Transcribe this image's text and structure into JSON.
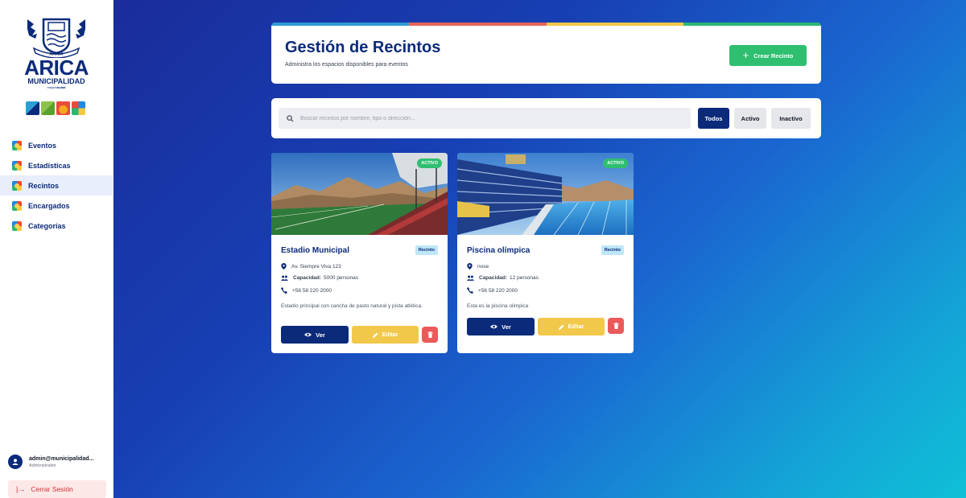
{
  "brand": {
    "name": "ARICA",
    "subtitle": "MUNICIPALIDAD",
    "tagline_prefix": "mejor",
    "tagline_bold": "ciudad",
    "crest_text": "ARICA",
    "tile_colors": [
      "#2a9fd6",
      "#8bc34a",
      "#f5a623",
      "#e94b3c",
      "#1e88e5"
    ]
  },
  "sidebar": {
    "items": [
      {
        "label": "Eventos",
        "active": false
      },
      {
        "label": "Estadísticas",
        "active": false
      },
      {
        "label": "Recintos",
        "active": true
      },
      {
        "label": "Encargados",
        "active": false
      },
      {
        "label": "Categorías",
        "active": false
      }
    ],
    "user": {
      "email": "admin@municipalidad...",
      "role": "Administrador"
    },
    "logout_label": "Cerrar Sesión"
  },
  "header": {
    "title": "Gestión de Recintos",
    "subtitle": "Administra los espacios disponibles para eventos",
    "create_label": "Crear Recinto",
    "stripe_colors": [
      "#2e9bd6",
      "#e8635a",
      "#f2c84b",
      "#2bb673"
    ]
  },
  "search": {
    "placeholder": "Buscar recintos por nombre, tipo o dirección...",
    "filters": [
      {
        "label": "Todos",
        "selected": true
      },
      {
        "label": "Activo",
        "selected": false
      },
      {
        "label": "Inactivo",
        "selected": false
      }
    ]
  },
  "venues": [
    {
      "name": "Estadio Municipal",
      "status": "ACTIVO",
      "type": "Recinto",
      "address": "Av. Siempre Viva 123",
      "capacity_label": "Capacidad:",
      "capacity_value": "5000 personas",
      "phone": "+56 58 220 2000",
      "description": "Estadio principal con cancha de pasto natural y pista atlética.",
      "view_label": "Ver",
      "edit_label": "Editar"
    },
    {
      "name": "Piscina olímpica",
      "status": "ACTIVO",
      "type": "Recinto",
      "address": "nose",
      "capacity_label": "Capacidad:",
      "capacity_value": "12 personas",
      "phone": "+56 58 220 2000",
      "description": "Esta es la piscina olimpica",
      "view_label": "Ver",
      "edit_label": "Editar"
    }
  ],
  "colors": {
    "primary": "#0b2a7a",
    "success": "#2fbf71",
    "warning": "#f2c84b",
    "danger": "#ea5a5a"
  }
}
